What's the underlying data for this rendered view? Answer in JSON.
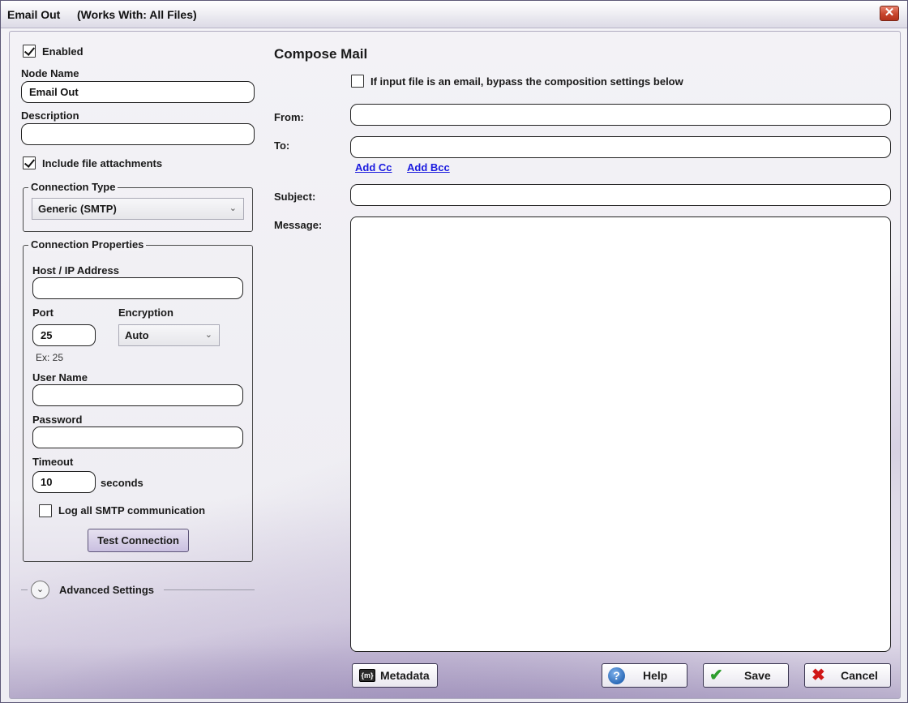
{
  "window": {
    "title": "Email Out",
    "works_with": "(Works With: All Files)",
    "close_glyph": "✕"
  },
  "left": {
    "enabled_label": "Enabled",
    "enabled_checked": true,
    "node_name_label": "Node Name",
    "node_name_value": "Email Out",
    "description_label": "Description",
    "description_value": "",
    "include_attachments_label": "Include file attachments",
    "include_attachments_checked": true,
    "connection_type": {
      "title": "Connection Type",
      "selected": "Generic (SMTP)"
    },
    "connection_properties": {
      "title": "Connection Properties",
      "host_label": "Host / IP Address",
      "host_value": "",
      "port_label": "Port",
      "port_value": "25",
      "port_hint": "Ex: 25",
      "encryption_label": "Encryption",
      "encryption_selected": "Auto",
      "username_label": "User Name",
      "username_value": "",
      "password_label": "Password",
      "password_value": "",
      "timeout_label": "Timeout",
      "timeout_value": "10",
      "timeout_unit": "seconds",
      "log_smtp_label": "Log all SMTP communication",
      "log_smtp_checked": false,
      "test_button": "Test Connection"
    },
    "advanced_settings_label": "Advanced Settings"
  },
  "compose": {
    "title": "Compose Mail",
    "bypass_label": "If input file is an email, bypass the composition settings below",
    "bypass_checked": false,
    "from_label": "From:",
    "from_value": "",
    "to_label": "To:",
    "to_value": "",
    "add_cc": "Add Cc",
    "add_bcc": "Add Bcc",
    "subject_label": "Subject:",
    "subject_value": "",
    "message_label": "Message:",
    "message_value": ""
  },
  "footer": {
    "metadata_button": "Metadata",
    "help_button": "Help",
    "save_button": "Save",
    "cancel_button": "Cancel"
  },
  "colors": {
    "accent": "#c9bfe0",
    "link": "#1a1adf",
    "close": "#c8452c",
    "save_check": "#2e9e2e",
    "cancel_x": "#d01616",
    "help_icon": "#2d6bb8"
  }
}
